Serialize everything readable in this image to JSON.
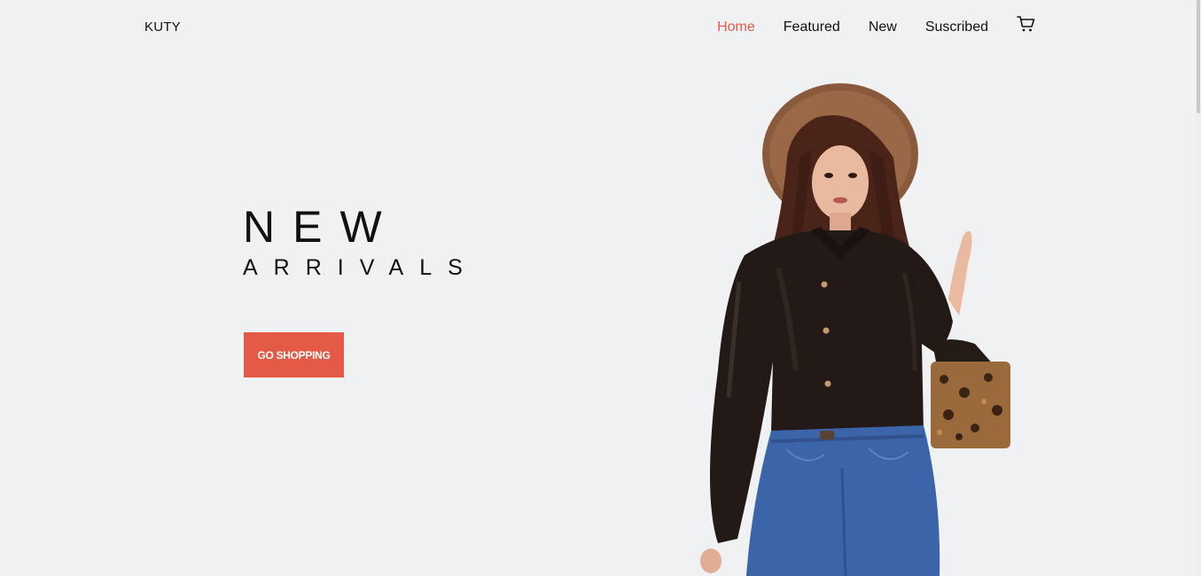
{
  "brand": {
    "logo": "KUTY"
  },
  "nav": {
    "items": [
      {
        "label": "Home",
        "active": true
      },
      {
        "label": "Featured",
        "active": false
      },
      {
        "label": "New",
        "active": false
      },
      {
        "label": "Suscribed",
        "active": false
      }
    ],
    "cart_icon": "cart-icon"
  },
  "hero": {
    "title": "NEW",
    "subtitle": "ARRIVALS",
    "cta_label": "GO SHOPPING",
    "image": "woman-in-hat-leather-shirt-jeans-with-leopard-handbag"
  },
  "colors": {
    "accent": "#e55a47",
    "background": "#f0f1f3",
    "text": "#111111"
  }
}
